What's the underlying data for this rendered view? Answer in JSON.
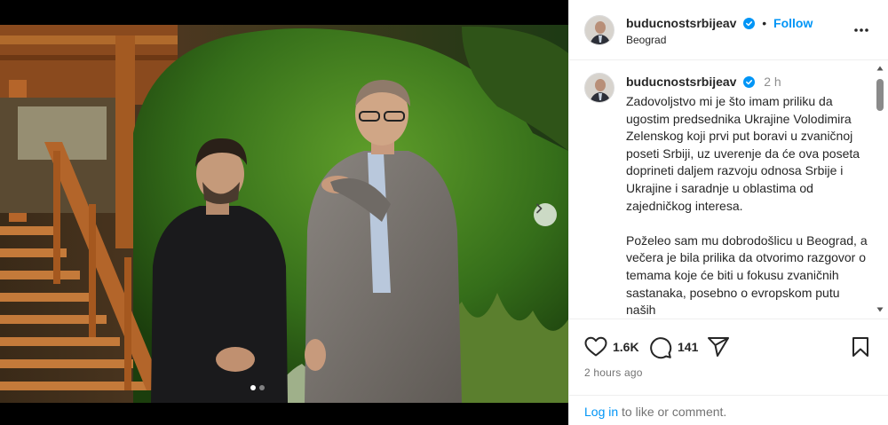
{
  "post": {
    "username": "buducnostsrbijeav",
    "location": "Beograd",
    "follow_label": "Follow",
    "separator": "•",
    "time_short": "2 h",
    "caption_paragraphs": [
      "Zadovoljstvo mi je što imam priliku da ugostim predsednika Ukrajine Volodimira Zelenskog koji prvi put boravi u zvaničnoj poseti Srbiji, uz uverenje da će ova poseta doprineti daljem razvoju odnosa Srbije i Ukrajine i saradnje u oblastima od zajedničkog interesa.",
      "Poželeo sam mu dobrodošlicu u Beograd, a večera je bila prilika da otvorimo razgovor o temama koje će biti u fokusu zvaničnih sastanaka, posebno o evropskom putu naših"
    ],
    "likes": "1.6K",
    "comments": "141",
    "time_ago": "2 hours ago"
  },
  "login": {
    "link": "Log in",
    "rest": " to like or comment."
  },
  "carousel": {
    "slide_count": 2,
    "active_index": 0
  },
  "colors": {
    "accent": "#0095f6",
    "text": "#262626",
    "muted": "#737373",
    "divider": "#efefef"
  },
  "icons": [
    "verified-badge-icon",
    "more-options-icon",
    "heart-icon",
    "comment-icon",
    "share-icon",
    "bookmark-icon",
    "chevron-right-icon"
  ]
}
